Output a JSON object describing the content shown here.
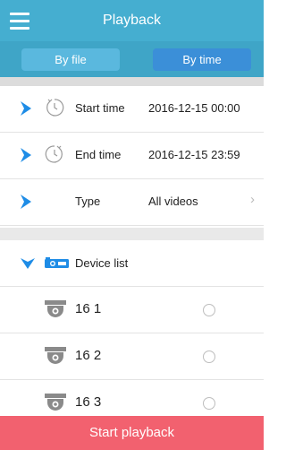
{
  "header": {
    "title": "Playback",
    "menu_icon": "hamburger-menu-icon"
  },
  "tabs": {
    "by_file": "By file",
    "by_time": "By time",
    "active": "By time"
  },
  "filters": {
    "start_time": {
      "label": "Start time",
      "value": "2016-12-15 00:00"
    },
    "end_time": {
      "label": "End time",
      "value": "2016-12-15 23:59"
    },
    "type": {
      "label": "Type",
      "value": "All videos"
    }
  },
  "device_list": {
    "label": "Device list",
    "devices": [
      {
        "name": "16 1",
        "selected": false
      },
      {
        "name": "16 2",
        "selected": false
      },
      {
        "name": "16 3",
        "selected": false
      }
    ]
  },
  "footer": {
    "start_label": "Start playback"
  },
  "colors": {
    "header": "#45aed0",
    "accent_blue": "#1e8ce6",
    "start_button": "#f2616f"
  }
}
